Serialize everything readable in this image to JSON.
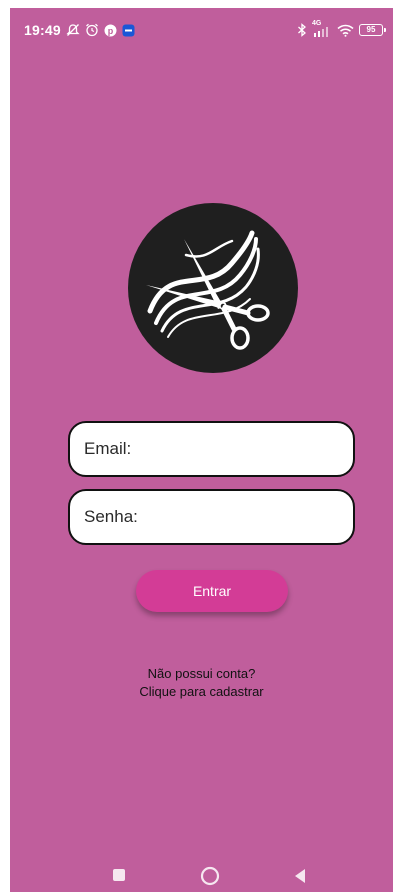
{
  "status_bar": {
    "time": "19:49",
    "network_type": "4G",
    "battery_level": "95"
  },
  "logo": {
    "icon": "scissors-hair-icon",
    "background_color": "#1f1f1f"
  },
  "form": {
    "email_placeholder": "Email:",
    "password_placeholder": "Senha:",
    "login_label": "Entrar"
  },
  "signup": {
    "line1": "Não possui conta?",
    "line2": "Clique para cadastrar"
  },
  "nav_bar": {
    "recents_icon": "square-icon",
    "home_icon": "circle-icon",
    "back_icon": "triangle-back-icon"
  },
  "colors": {
    "background": "#c05e9c",
    "button": "#d33c96",
    "field_background": "#ffffff",
    "field_border": "#111111"
  }
}
